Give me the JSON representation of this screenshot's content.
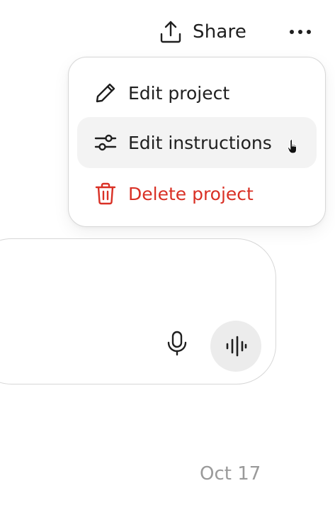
{
  "header": {
    "share_label": "Share",
    "share_icon": "share-upload-icon",
    "more_icon": "more-horizontal-icon"
  },
  "menu": {
    "items": [
      {
        "label": "Edit project",
        "icon": "pencil-icon",
        "state": "normal"
      },
      {
        "label": "Edit instructions",
        "icon": "sliders-icon",
        "state": "hovered"
      },
      {
        "label": "Delete project",
        "icon": "trash-icon",
        "state": "danger"
      }
    ]
  },
  "composer": {
    "mic_icon": "microphone-icon",
    "voice_icon": "voice-waveform-icon"
  },
  "cursor": "hand-pointer-cursor",
  "footer": {
    "date": "Oct 17"
  },
  "colors": {
    "text": "#1f1f1f",
    "danger": "#d93025",
    "border": "#d7d7d7",
    "hover_bg": "#f3f3f3",
    "voice_bg": "#ececec",
    "muted": "#9a9a9a"
  }
}
